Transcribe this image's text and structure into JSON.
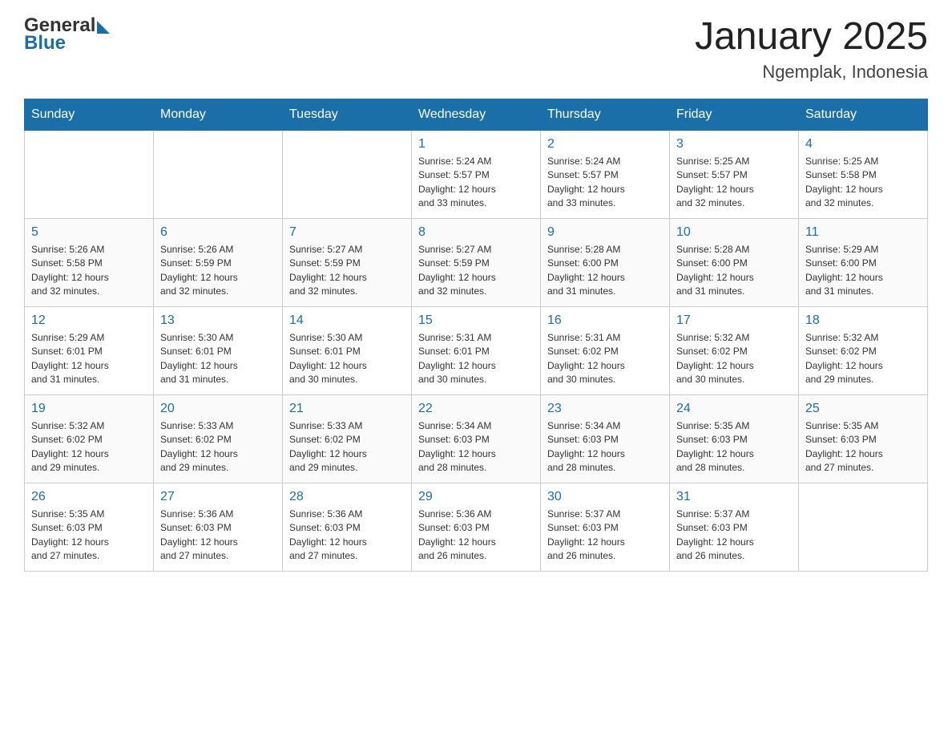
{
  "header": {
    "logo_general": "General",
    "logo_blue": "Blue",
    "title": "January 2025",
    "subtitle": "Ngemplak, Indonesia"
  },
  "calendar": {
    "days_of_week": [
      "Sunday",
      "Monday",
      "Tuesday",
      "Wednesday",
      "Thursday",
      "Friday",
      "Saturday"
    ],
    "weeks": [
      [
        {
          "day": "",
          "info": ""
        },
        {
          "day": "",
          "info": ""
        },
        {
          "day": "",
          "info": ""
        },
        {
          "day": "1",
          "info": "Sunrise: 5:24 AM\nSunset: 5:57 PM\nDaylight: 12 hours\nand 33 minutes."
        },
        {
          "day": "2",
          "info": "Sunrise: 5:24 AM\nSunset: 5:57 PM\nDaylight: 12 hours\nand 33 minutes."
        },
        {
          "day": "3",
          "info": "Sunrise: 5:25 AM\nSunset: 5:57 PM\nDaylight: 12 hours\nand 32 minutes."
        },
        {
          "day": "4",
          "info": "Sunrise: 5:25 AM\nSunset: 5:58 PM\nDaylight: 12 hours\nand 32 minutes."
        }
      ],
      [
        {
          "day": "5",
          "info": "Sunrise: 5:26 AM\nSunset: 5:58 PM\nDaylight: 12 hours\nand 32 minutes."
        },
        {
          "day": "6",
          "info": "Sunrise: 5:26 AM\nSunset: 5:59 PM\nDaylight: 12 hours\nand 32 minutes."
        },
        {
          "day": "7",
          "info": "Sunrise: 5:27 AM\nSunset: 5:59 PM\nDaylight: 12 hours\nand 32 minutes."
        },
        {
          "day": "8",
          "info": "Sunrise: 5:27 AM\nSunset: 5:59 PM\nDaylight: 12 hours\nand 32 minutes."
        },
        {
          "day": "9",
          "info": "Sunrise: 5:28 AM\nSunset: 6:00 PM\nDaylight: 12 hours\nand 31 minutes."
        },
        {
          "day": "10",
          "info": "Sunrise: 5:28 AM\nSunset: 6:00 PM\nDaylight: 12 hours\nand 31 minutes."
        },
        {
          "day": "11",
          "info": "Sunrise: 5:29 AM\nSunset: 6:00 PM\nDaylight: 12 hours\nand 31 minutes."
        }
      ],
      [
        {
          "day": "12",
          "info": "Sunrise: 5:29 AM\nSunset: 6:01 PM\nDaylight: 12 hours\nand 31 minutes."
        },
        {
          "day": "13",
          "info": "Sunrise: 5:30 AM\nSunset: 6:01 PM\nDaylight: 12 hours\nand 31 minutes."
        },
        {
          "day": "14",
          "info": "Sunrise: 5:30 AM\nSunset: 6:01 PM\nDaylight: 12 hours\nand 30 minutes."
        },
        {
          "day": "15",
          "info": "Sunrise: 5:31 AM\nSunset: 6:01 PM\nDaylight: 12 hours\nand 30 minutes."
        },
        {
          "day": "16",
          "info": "Sunrise: 5:31 AM\nSunset: 6:02 PM\nDaylight: 12 hours\nand 30 minutes."
        },
        {
          "day": "17",
          "info": "Sunrise: 5:32 AM\nSunset: 6:02 PM\nDaylight: 12 hours\nand 30 minutes."
        },
        {
          "day": "18",
          "info": "Sunrise: 5:32 AM\nSunset: 6:02 PM\nDaylight: 12 hours\nand 29 minutes."
        }
      ],
      [
        {
          "day": "19",
          "info": "Sunrise: 5:32 AM\nSunset: 6:02 PM\nDaylight: 12 hours\nand 29 minutes."
        },
        {
          "day": "20",
          "info": "Sunrise: 5:33 AM\nSunset: 6:02 PM\nDaylight: 12 hours\nand 29 minutes."
        },
        {
          "day": "21",
          "info": "Sunrise: 5:33 AM\nSunset: 6:02 PM\nDaylight: 12 hours\nand 29 minutes."
        },
        {
          "day": "22",
          "info": "Sunrise: 5:34 AM\nSunset: 6:03 PM\nDaylight: 12 hours\nand 28 minutes."
        },
        {
          "day": "23",
          "info": "Sunrise: 5:34 AM\nSunset: 6:03 PM\nDaylight: 12 hours\nand 28 minutes."
        },
        {
          "day": "24",
          "info": "Sunrise: 5:35 AM\nSunset: 6:03 PM\nDaylight: 12 hours\nand 28 minutes."
        },
        {
          "day": "25",
          "info": "Sunrise: 5:35 AM\nSunset: 6:03 PM\nDaylight: 12 hours\nand 27 minutes."
        }
      ],
      [
        {
          "day": "26",
          "info": "Sunrise: 5:35 AM\nSunset: 6:03 PM\nDaylight: 12 hours\nand 27 minutes."
        },
        {
          "day": "27",
          "info": "Sunrise: 5:36 AM\nSunset: 6:03 PM\nDaylight: 12 hours\nand 27 minutes."
        },
        {
          "day": "28",
          "info": "Sunrise: 5:36 AM\nSunset: 6:03 PM\nDaylight: 12 hours\nand 27 minutes."
        },
        {
          "day": "29",
          "info": "Sunrise: 5:36 AM\nSunset: 6:03 PM\nDaylight: 12 hours\nand 26 minutes."
        },
        {
          "day": "30",
          "info": "Sunrise: 5:37 AM\nSunset: 6:03 PM\nDaylight: 12 hours\nand 26 minutes."
        },
        {
          "day": "31",
          "info": "Sunrise: 5:37 AM\nSunset: 6:03 PM\nDaylight: 12 hours\nand 26 minutes."
        },
        {
          "day": "",
          "info": ""
        }
      ]
    ]
  }
}
